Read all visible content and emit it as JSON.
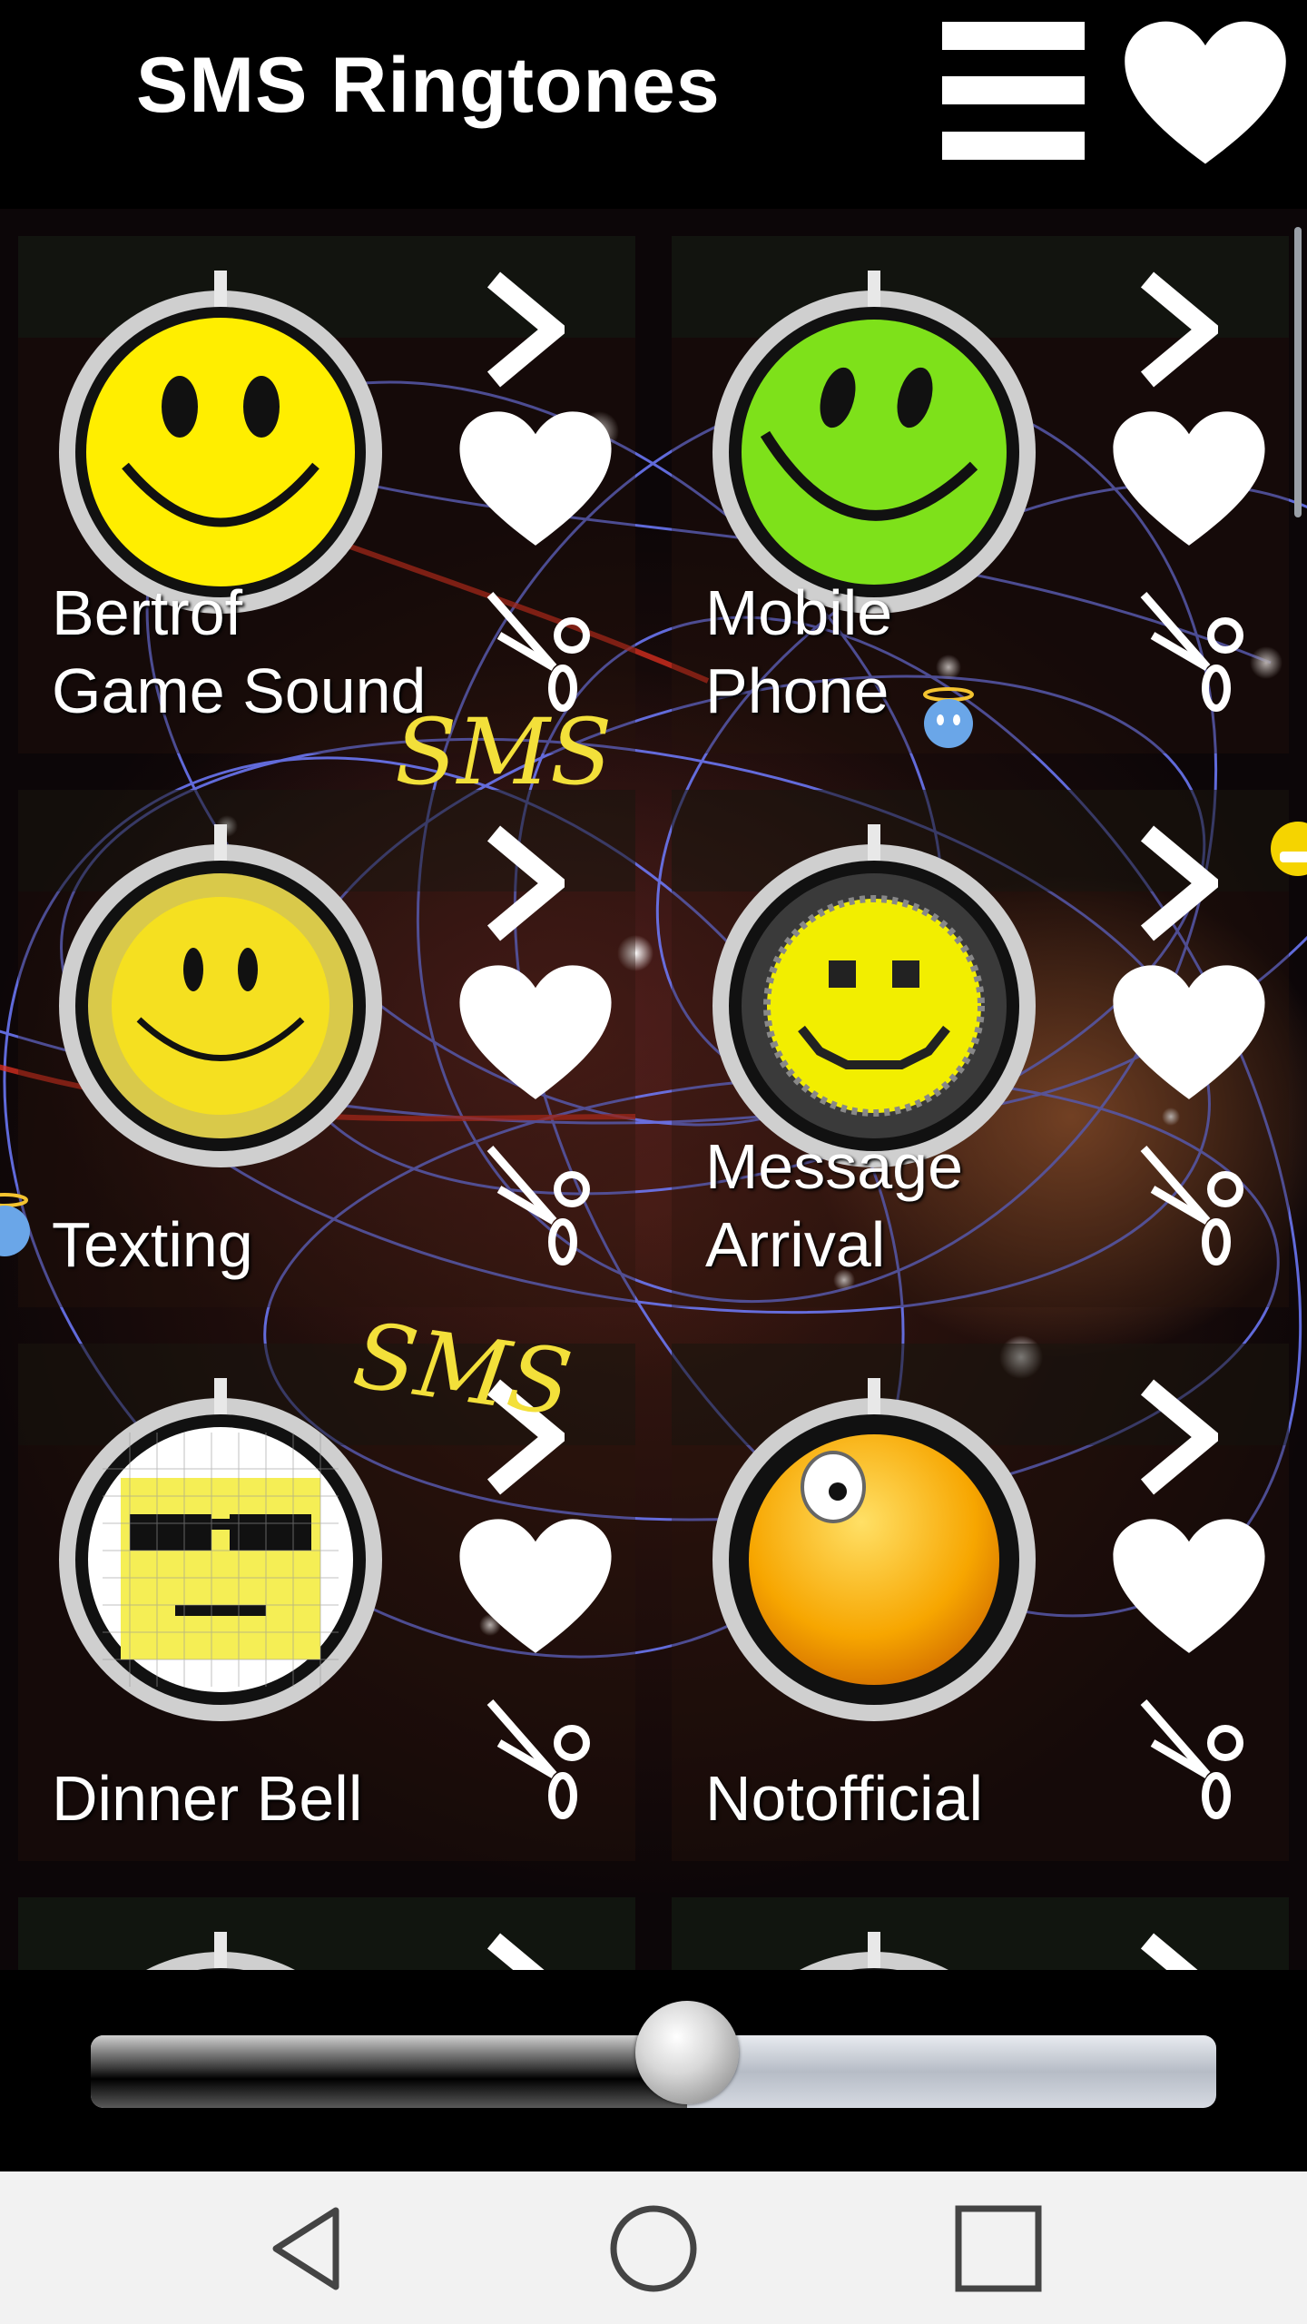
{
  "header": {
    "title": "SMS Ringtones",
    "menu_icon": "menu-icon",
    "favorites_icon": "heart-icon"
  },
  "ringtones": [
    {
      "line1": "Bertrof",
      "line2": "Game Sound",
      "icon": "yellow-smiley"
    },
    {
      "line1": "Mobile",
      "line2": "Phone",
      "icon": "green-smiley"
    },
    {
      "line1": "Texting",
      "icon": "gold-smiley"
    },
    {
      "line1": "Message",
      "line2": "Arrival",
      "icon": "pixel-smiley"
    },
    {
      "line1": "Dinner Bell",
      "icon": "pixel-sunglasses-smiley"
    },
    {
      "line1": "Notofficial",
      "icon": "winking-orange-smiley"
    }
  ],
  "decorations": {
    "sms_text_1": "SMS",
    "sms_text_2": "SMS"
  },
  "player": {
    "volume_fraction": 0.53
  },
  "navbar": {
    "back_icon": "back-icon",
    "home_icon": "home-icon",
    "recents_icon": "recents-icon"
  },
  "colors": {
    "background": "#000000",
    "accent_text": "#f3e03a",
    "navbar": "#f2f2f2"
  }
}
